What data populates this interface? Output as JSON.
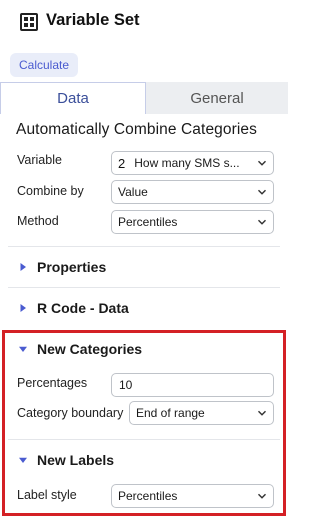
{
  "header": {
    "title": "Variable Set",
    "icon": "grid-icon"
  },
  "calculate_button": "Calculate",
  "tabs": [
    {
      "label": "Data",
      "active": true
    },
    {
      "label": "General",
      "active": false
    }
  ],
  "section_title": "Automatically Combine Categories",
  "fields": {
    "variable": {
      "label": "Variable",
      "badge": "2",
      "value": "How many SMS s..."
    },
    "combine_by": {
      "label": "Combine by",
      "value": "Value"
    },
    "method": {
      "label": "Method",
      "value": "Percentiles"
    }
  },
  "groups": {
    "properties": {
      "label": "Properties",
      "expanded": false
    },
    "r_code": {
      "label": "R Code - Data",
      "expanded": false
    },
    "new_categories": {
      "label": "New Categories",
      "expanded": true,
      "percentages": {
        "label": "Percentages",
        "value": "10"
      },
      "category_boundary": {
        "label": "Category boundary",
        "value": "End of range"
      }
    },
    "new_labels": {
      "label": "New Labels",
      "expanded": true,
      "label_style": {
        "label": "Label style",
        "value": "Percentiles"
      }
    }
  },
  "colors": {
    "accent": "#3b4f9a",
    "triangle": "#4a5bd0",
    "highlight": "#d42025"
  }
}
